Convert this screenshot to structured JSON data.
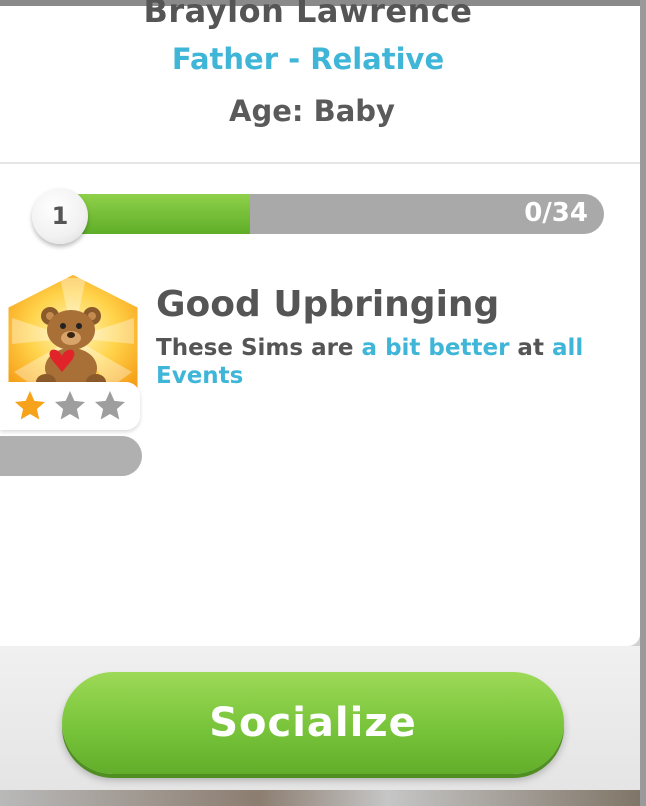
{
  "sim": {
    "name": "Braylon Lawrence",
    "relation": "Father - Relative",
    "age": "Age: Baby"
  },
  "progress": {
    "level": "1",
    "count": "0/34",
    "fill_fraction": 0.35,
    "fill_color": "#6fbf33"
  },
  "trait": {
    "title": "Good Upbringing",
    "desc_part1": "These Sims are ",
    "desc_highlight1": "a bit better",
    "desc_part2": " at ",
    "desc_highlight2": "all Events",
    "icon": "teddy-bear-icon",
    "stars_filled": 1,
    "stars_total": 3,
    "highlight_color": "#3fb6d8"
  },
  "actions": {
    "socialize_label": "Socialize"
  }
}
